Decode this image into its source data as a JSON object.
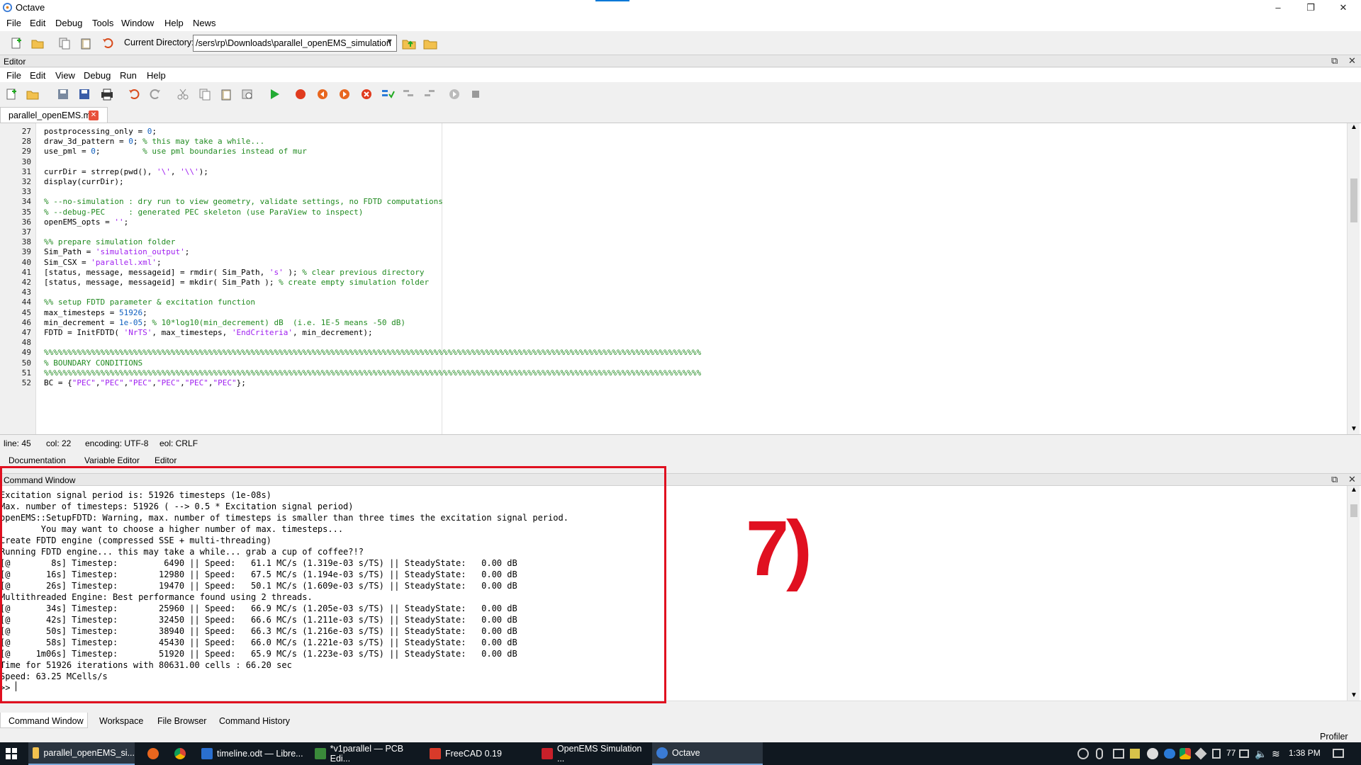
{
  "app": {
    "title": "Octave"
  },
  "menubar": [
    "File",
    "Edit",
    "Debug",
    "Tools",
    "Window",
    "Help",
    "News"
  ],
  "toolbar": {
    "current_directory_label": "Current Directory:",
    "current_directory_value": "/sers\\rp\\Downloads\\parallel_openEMS_simulation"
  },
  "editor": {
    "header_title": "Editor",
    "menu": [
      "File",
      "Edit",
      "View",
      "Debug",
      "Run",
      "Help"
    ],
    "file_tab": "parallel_openEMS.m",
    "lines": [
      {
        "n": "27",
        "segs": [
          [
            "postprocessing_only = ",
            ""
          ],
          [
            "0",
            "nm"
          ],
          [
            ";",
            ""
          ]
        ]
      },
      {
        "n": "28",
        "segs": [
          [
            "draw_3d_pattern = ",
            ""
          ],
          [
            "0",
            "nm"
          ],
          [
            "; ",
            ""
          ],
          [
            "% this may take a while...",
            "cm"
          ]
        ]
      },
      {
        "n": "29",
        "segs": [
          [
            "use_pml = ",
            ""
          ],
          [
            "0",
            "nm"
          ],
          [
            ";         ",
            ""
          ],
          [
            "% use pml boundaries instead of mur",
            "cm"
          ]
        ]
      },
      {
        "n": "30",
        "segs": []
      },
      {
        "n": "31",
        "segs": [
          [
            "currDir = strrep(pwd(), ",
            ""
          ],
          [
            "'\\'",
            "st"
          ],
          [
            ", ",
            ""
          ],
          [
            "'\\\\'",
            "st"
          ],
          [
            ");",
            ""
          ]
        ]
      },
      {
        "n": "32",
        "segs": [
          [
            "display(currDir);",
            ""
          ]
        ]
      },
      {
        "n": "33",
        "segs": []
      },
      {
        "n": "34",
        "segs": [
          [
            "% --no-simulation : dry run to view geometry, validate settings, no FDTD computations",
            "cm"
          ]
        ]
      },
      {
        "n": "35",
        "segs": [
          [
            "% --debug-PEC     : generated PEC skeleton (use ParaView to inspect)",
            "cm"
          ]
        ]
      },
      {
        "n": "36",
        "segs": [
          [
            "openEMS_opts = ",
            ""
          ],
          [
            "''",
            "st"
          ],
          [
            ";",
            ""
          ]
        ]
      },
      {
        "n": "37",
        "segs": []
      },
      {
        "n": "38",
        "segs": [
          [
            "%% prepare simulation folder",
            "cm"
          ]
        ]
      },
      {
        "n": "39",
        "segs": [
          [
            "Sim_Path = ",
            ""
          ],
          [
            "'simulation_output'",
            "st"
          ],
          [
            ";",
            ""
          ]
        ]
      },
      {
        "n": "40",
        "segs": [
          [
            "Sim_CSX = ",
            ""
          ],
          [
            "'parallel.xml'",
            "st"
          ],
          [
            ";",
            ""
          ]
        ]
      },
      {
        "n": "41",
        "segs": [
          [
            "[status, message, messageid] = rmdir( Sim_Path, ",
            ""
          ],
          [
            "'s'",
            "st"
          ],
          [
            " ); ",
            ""
          ],
          [
            "% clear previous directory",
            "cm"
          ]
        ]
      },
      {
        "n": "42",
        "segs": [
          [
            "[status, message, messageid] = mkdir( Sim_Path ); ",
            ""
          ],
          [
            "% create empty simulation folder",
            "cm"
          ]
        ]
      },
      {
        "n": "43",
        "segs": []
      },
      {
        "n": "44",
        "segs": [
          [
            "%% setup FDTD parameter & excitation function",
            "cm"
          ]
        ]
      },
      {
        "n": "45",
        "segs": [
          [
            "max_timesteps = ",
            ""
          ],
          [
            "51926",
            "nm"
          ],
          [
            ";",
            ""
          ]
        ]
      },
      {
        "n": "46",
        "segs": [
          [
            "min_decrement = ",
            ""
          ],
          [
            "1e-05",
            "nm"
          ],
          [
            "; ",
            ""
          ],
          [
            "% 10*log10(min_decrement) dB  (i.e. 1E-5 means -50 dB)",
            "cm"
          ]
        ]
      },
      {
        "n": "47",
        "segs": [
          [
            "FDTD = InitFDTD( ",
            ""
          ],
          [
            "'NrTS'",
            "st"
          ],
          [
            ", max_timesteps, ",
            ""
          ],
          [
            "'EndCriteria'",
            "st"
          ],
          [
            ", min_decrement);",
            ""
          ]
        ]
      },
      {
        "n": "48",
        "segs": []
      },
      {
        "n": "49",
        "segs": [
          [
            "%%%%%%%%%%%%%%%%%%%%%%%%%%%%%%%%%%%%%%%%%%%%%%%%%%%%%%%%%%%%%%%%%%%%%%%%%%%%%%%%%%%%%%%%%%%%%%%%%%%%%%%%%%%%%%%%%%%%%%%%%%%%%%%%%%%%%%%%%%%%",
            "cm"
          ]
        ]
      },
      {
        "n": "50",
        "segs": [
          [
            "% BOUNDARY CONDITIONS",
            "cm"
          ]
        ]
      },
      {
        "n": "51",
        "segs": [
          [
            "%%%%%%%%%%%%%%%%%%%%%%%%%%%%%%%%%%%%%%%%%%%%%%%%%%%%%%%%%%%%%%%%%%%%%%%%%%%%%%%%%%%%%%%%%%%%%%%%%%%%%%%%%%%%%%%%%%%%%%%%%%%%%%%%%%%%%%%%%%%%",
            "cm"
          ]
        ]
      },
      {
        "n": "52",
        "segs": [
          [
            "BC = {",
            ""
          ],
          [
            "\"PEC\"",
            "st"
          ],
          [
            ",",
            ""
          ],
          [
            "\"PEC\"",
            "st"
          ],
          [
            ",",
            ""
          ],
          [
            "\"PEC\"",
            "st"
          ],
          [
            ",",
            ""
          ],
          [
            "\"PEC\"",
            "st"
          ],
          [
            ",",
            ""
          ],
          [
            "\"PEC\"",
            "st"
          ],
          [
            ",",
            ""
          ],
          [
            "\"PEC\"",
            "st"
          ],
          [
            "};",
            ""
          ]
        ]
      }
    ],
    "status": {
      "line": "line: 45",
      "col": "col: 22",
      "encoding": "encoding: UTF-8",
      "eol": "eol: CRLF"
    }
  },
  "dock_tabs": [
    "Documentation",
    "Variable Editor",
    "Editor"
  ],
  "command_window": {
    "title": "Command Window",
    "lines": [
      "Excitation signal period is: 51926 timesteps (1e-08s)",
      "Max. number of timesteps: 51926 ( --> 0.5 * Excitation signal period)",
      "openEMS::SetupFDTD: Warning, max. number of timesteps is smaller than three times the excitation signal period.",
      "        You may want to choose a higher number of max. timesteps...",
      "Create FDTD engine (compressed SSE + multi-threading)",
      "Running FDTD engine... this may take a while... grab a cup of coffee?!?",
      "[@        8s] Timestep:         6490 || Speed:   61.1 MC/s (1.319e-03 s/TS) || SteadyState:   0.00 dB",
      "[@       16s] Timestep:        12980 || Speed:   67.5 MC/s (1.194e-03 s/TS) || SteadyState:   0.00 dB",
      "[@       26s] Timestep:        19470 || Speed:   50.1 MC/s (1.609e-03 s/TS) || SteadyState:   0.00 dB",
      "Multithreaded Engine: Best performance found using 2 threads.",
      "[@       34s] Timestep:        25960 || Speed:   66.9 MC/s (1.205e-03 s/TS) || SteadyState:   0.00 dB",
      "[@       42s] Timestep:        32450 || Speed:   66.6 MC/s (1.211e-03 s/TS) || SteadyState:   0.00 dB",
      "[@       50s] Timestep:        38940 || Speed:   66.3 MC/s (1.216e-03 s/TS) || SteadyState:   0.00 dB",
      "[@       58s] Timestep:        45430 || Speed:   66.0 MC/s (1.221e-03 s/TS) || SteadyState:   0.00 dB",
      "[@     1m06s] Timestep:        51920 || Speed:   65.9 MC/s (1.223e-03 s/TS) || SteadyState:   0.00 dB",
      "Time for 51926 iterations with 80631.00 cells : 66.20 sec",
      "Speed: 63.25 MCells/s",
      ">> "
    ]
  },
  "annotation": {
    "marker_text": "7)",
    "color": "#e01020"
  },
  "bottom_tabs": [
    "Command Window",
    "Workspace",
    "File Browser",
    "Command History"
  ],
  "profiler_label": "Profiler",
  "taskbar": {
    "apps": [
      {
        "label": "parallel_openEMS_si...",
        "icon": "folder-icon"
      },
      {
        "label": "timeline.odt — Libre...",
        "icon": "writer-icon"
      },
      {
        "label": "*v1parallel — PCB Edi...",
        "icon": "kicad-icon"
      },
      {
        "label": "FreeCAD 0.19",
        "icon": "freecad-icon"
      },
      {
        "label": "OpenEMS Simulation ...",
        "icon": "pdf-icon"
      },
      {
        "label": "Octave",
        "icon": "octave-icon"
      }
    ],
    "tray_number": "77",
    "clock": "1:38 PM"
  }
}
